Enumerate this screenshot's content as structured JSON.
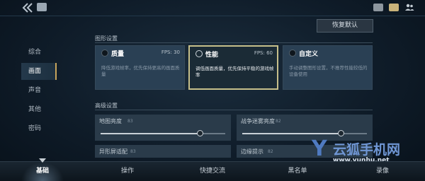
{
  "actions": {
    "restore_defaults": "恢复默认"
  },
  "sections": {
    "graphics": "图形设置",
    "advanced": "高级设置"
  },
  "sidebar": {
    "items": [
      {
        "label": "综合",
        "active": false
      },
      {
        "label": "画面",
        "active": true
      },
      {
        "label": "声音",
        "active": false
      },
      {
        "label": "其他",
        "active": false
      },
      {
        "label": "密码",
        "active": false
      }
    ]
  },
  "presets": [
    {
      "title": "质量",
      "fps": "FPS: 30",
      "desc": "降低游戏帧率，优先保持更高的画面质量",
      "selected": false
    },
    {
      "title": "性能",
      "fps": "FPS: 60",
      "desc": "调低画面质量，优先保持平稳的游戏帧率",
      "selected": true
    },
    {
      "title": "自定义",
      "fps": "",
      "desc": "手动调整图形设置，不推荐性能较低的设备使用",
      "selected": false
    }
  ],
  "advanced": {
    "sliders": [
      {
        "label": "地图亮度",
        "value": "83",
        "level": 0.8
      },
      {
        "label": "战争迷雾亮度",
        "value": "82",
        "level": 0.79
      }
    ],
    "rows": [
      {
        "label": "异形屏适配",
        "value": "83"
      },
      {
        "label": "边缘提示",
        "value": "82"
      }
    ]
  },
  "bottom_nav": [
    {
      "label": "基础",
      "active": true
    },
    {
      "label": "操作",
      "active": false
    },
    {
      "label": "快捷交流",
      "active": false
    },
    {
      "label": "黑名单",
      "active": false
    },
    {
      "label": "录像",
      "active": false
    }
  ],
  "watermark": {
    "letter": "Y",
    "name": "云狐手机网",
    "url": "www.yunhu.net"
  },
  "colors": {
    "accent_gold": "#c6bf8a",
    "panel": "#2a4054",
    "background": "#0f1c29"
  },
  "icons": [
    "back-arrow-icon",
    "home-icon",
    "treasure-chest-icon",
    "chat-icon",
    "friends-icon"
  ]
}
